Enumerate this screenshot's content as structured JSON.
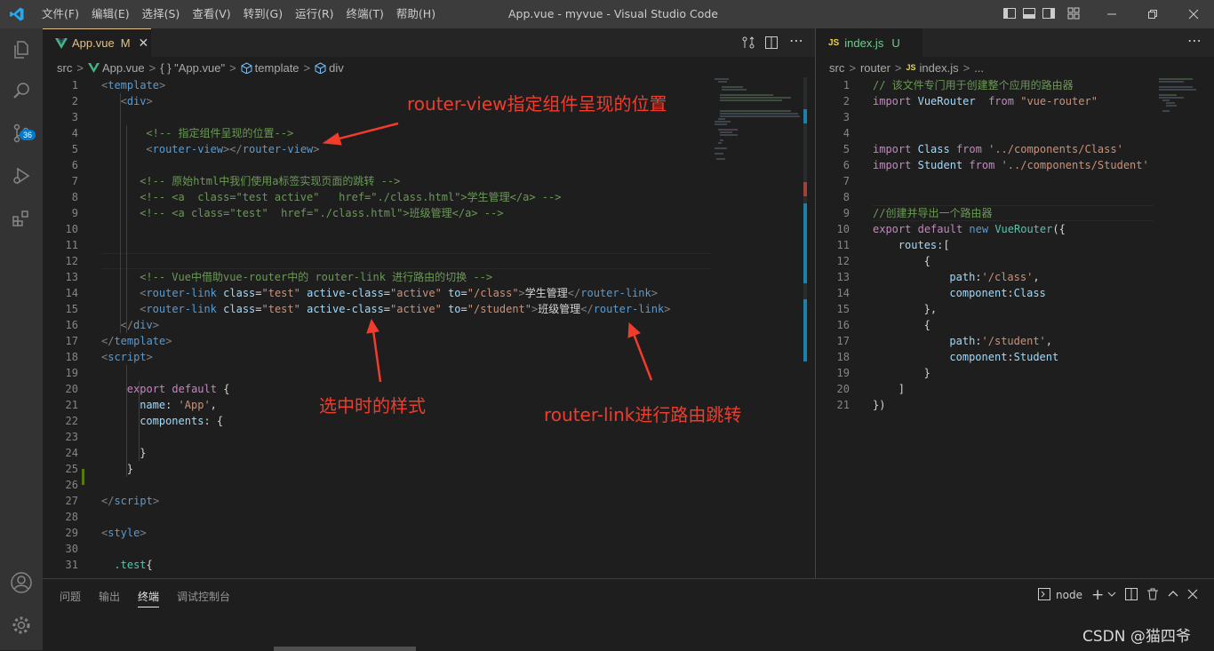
{
  "titlebar": {
    "menu": [
      "文件(F)",
      "编辑(E)",
      "选择(S)",
      "查看(V)",
      "转到(G)",
      "运行(R)",
      "终端(T)",
      "帮助(H)"
    ],
    "title": "App.vue - myvue - Visual Studio Code"
  },
  "activity": {
    "scm_badge": "36"
  },
  "left_tab": {
    "name": "App.vue",
    "status": "M"
  },
  "left_breadcrumb": [
    "src",
    "App.vue",
    "{ } \"App.vue\"",
    "template",
    "div"
  ],
  "right_tab": {
    "lang": "JS",
    "name": "index.js",
    "status": "U"
  },
  "right_breadcrumb": [
    "src",
    "router",
    "index.js",
    "..."
  ],
  "left_lines": [
    {
      "n": "1",
      "t": [
        [
          "t-pun",
          "<"
        ],
        [
          "t-tag",
          "template"
        ],
        [
          "t-pun",
          ">"
        ]
      ],
      "i": 0
    },
    {
      "n": "2",
      "t": [
        [
          "t-pun",
          "<"
        ],
        [
          "t-tag",
          "div"
        ],
        [
          "t-pun",
          ">"
        ]
      ],
      "i": 3
    },
    {
      "n": "3",
      "t": [],
      "i": 0
    },
    {
      "n": "4",
      "t": [
        [
          "t-com",
          "<!-- 指定组件呈现的位置-->"
        ]
      ],
      "i": 7
    },
    {
      "n": "5",
      "t": [
        [
          "t-pun",
          "<"
        ],
        [
          "t-tag",
          "router-view"
        ],
        [
          "t-pun",
          "></"
        ],
        [
          "t-tag",
          "router-view"
        ],
        [
          "t-pun",
          ">"
        ]
      ],
      "i": 7
    },
    {
      "n": "6",
      "t": [],
      "i": 0
    },
    {
      "n": "7",
      "t": [
        [
          "t-com",
          "<!-- 原始html中我们使用a标签实现页面的跳转 -->"
        ]
      ],
      "i": 6
    },
    {
      "n": "8",
      "t": [
        [
          "t-com",
          "<!-- <a  class=\"test active\"   href=\"./class.html\">学生管理</a> -->"
        ]
      ],
      "i": 6
    },
    {
      "n": "9",
      "t": [
        [
          "t-com",
          "<!-- <a class=\"test\"  href=\"./class.html\">班级管理</a> -->"
        ]
      ],
      "i": 6
    },
    {
      "n": "10",
      "t": [],
      "i": 0
    },
    {
      "n": "11",
      "t": [],
      "i": 0
    },
    {
      "n": "12",
      "t": [],
      "i": 0
    },
    {
      "n": "13",
      "t": [
        [
          "t-com",
          "<!-- Vue中借助vue-router中的 router-link 进行路由的切换 -->"
        ]
      ],
      "i": 6
    },
    {
      "n": "14",
      "t": [
        [
          "t-pun",
          "<"
        ],
        [
          "t-tag",
          "router-link"
        ],
        [
          "t-txt",
          " "
        ],
        [
          "t-attr",
          "class"
        ],
        [
          "t-txt",
          "="
        ],
        [
          "t-str",
          "\"test\""
        ],
        [
          "t-txt",
          " "
        ],
        [
          "t-attr",
          "active-class"
        ],
        [
          "t-txt",
          "="
        ],
        [
          "t-str",
          "\"active\""
        ],
        [
          "t-txt",
          " "
        ],
        [
          "t-attr",
          "to"
        ],
        [
          "t-txt",
          "="
        ],
        [
          "t-str",
          "\"/class\""
        ],
        [
          "t-pun",
          ">"
        ],
        [
          "t-txt",
          "学生管理"
        ],
        [
          "t-pun",
          "</"
        ],
        [
          "t-tag",
          "router-link"
        ],
        [
          "t-pun",
          ">"
        ]
      ],
      "i": 6
    },
    {
      "n": "15",
      "t": [
        [
          "t-pun",
          "<"
        ],
        [
          "t-tag",
          "router-link"
        ],
        [
          "t-txt",
          " "
        ],
        [
          "t-attr",
          "class"
        ],
        [
          "t-txt",
          "="
        ],
        [
          "t-str",
          "\"test\""
        ],
        [
          "t-txt",
          " "
        ],
        [
          "t-attr",
          "active-class"
        ],
        [
          "t-txt",
          "="
        ],
        [
          "t-str",
          "\"active\""
        ],
        [
          "t-txt",
          " "
        ],
        [
          "t-attr",
          "to"
        ],
        [
          "t-txt",
          "="
        ],
        [
          "t-str",
          "\"/student\""
        ],
        [
          "t-pun",
          ">"
        ],
        [
          "t-txt",
          "班级管理"
        ],
        [
          "t-pun",
          "</"
        ],
        [
          "t-tag",
          "router-link"
        ],
        [
          "t-pun",
          ">"
        ]
      ],
      "i": 6
    },
    {
      "n": "16",
      "t": [
        [
          "t-pun",
          "</"
        ],
        [
          "t-tag",
          "div"
        ],
        [
          "t-pun",
          ">"
        ]
      ],
      "i": 3
    },
    {
      "n": "17",
      "t": [
        [
          "t-pun",
          "</"
        ],
        [
          "t-tag",
          "template"
        ],
        [
          "t-pun",
          ">"
        ]
      ],
      "i": 0
    },
    {
      "n": "18",
      "t": [
        [
          "t-pun",
          "<"
        ],
        [
          "t-tag",
          "script"
        ],
        [
          "t-pun",
          ">"
        ]
      ],
      "i": 0
    },
    {
      "n": "19",
      "t": [],
      "i": 0
    },
    {
      "n": "20",
      "t": [
        [
          "t-kw",
          "export"
        ],
        [
          "t-txt",
          " "
        ],
        [
          "t-kw",
          "default"
        ],
        [
          "t-txt",
          " {"
        ]
      ],
      "i": 4
    },
    {
      "n": "21",
      "t": [
        [
          "t-attr",
          "name"
        ],
        [
          "t-txt",
          ": "
        ],
        [
          "t-str",
          "'App'"
        ],
        [
          "t-txt",
          ","
        ]
      ],
      "i": 6
    },
    {
      "n": "22",
      "t": [
        [
          "t-attr",
          "components"
        ],
        [
          "t-txt",
          ": {"
        ]
      ],
      "i": 6
    },
    {
      "n": "23",
      "t": [],
      "i": 0
    },
    {
      "n": "24",
      "t": [
        [
          "t-txt",
          "}"
        ]
      ],
      "i": 6
    },
    {
      "n": "25",
      "t": [
        [
          "t-txt",
          "}"
        ]
      ],
      "i": 4
    },
    {
      "n": "26",
      "t": [],
      "i": 0
    },
    {
      "n": "27",
      "t": [
        [
          "t-pun",
          "</"
        ],
        [
          "t-tag",
          "script"
        ],
        [
          "t-pun",
          ">"
        ]
      ],
      "i": 0
    },
    {
      "n": "28",
      "t": [],
      "i": 0
    },
    {
      "n": "29",
      "t": [
        [
          "t-pun",
          "<"
        ],
        [
          "t-tag",
          "style"
        ],
        [
          "t-pun",
          ">"
        ]
      ],
      "i": 0
    },
    {
      "n": "30",
      "t": [],
      "i": 0
    },
    {
      "n": "31",
      "t": [
        [
          "t-cls",
          ".test"
        ],
        [
          "t-txt",
          "{"
        ]
      ],
      "i": 2
    }
  ],
  "right_lines": [
    {
      "n": "1",
      "t": [
        [
          "t-com",
          "// 该文件专门用于创建整个应用的路由器"
        ]
      ],
      "i": 0
    },
    {
      "n": "2",
      "t": [
        [
          "t-kw",
          "import"
        ],
        [
          "t-txt",
          " "
        ],
        [
          "t-attr",
          "VueRouter"
        ],
        [
          "t-txt",
          "  "
        ],
        [
          "t-kw",
          "from"
        ],
        [
          "t-txt",
          " "
        ],
        [
          "t-str",
          "\"vue-router\""
        ]
      ],
      "i": 0
    },
    {
      "n": "3",
      "t": [],
      "i": 0
    },
    {
      "n": "4",
      "t": [],
      "i": 0
    },
    {
      "n": "5",
      "t": [
        [
          "t-kw",
          "import"
        ],
        [
          "t-txt",
          " "
        ],
        [
          "t-attr",
          "Class"
        ],
        [
          "t-txt",
          " "
        ],
        [
          "t-kw",
          "from"
        ],
        [
          "t-txt",
          " "
        ],
        [
          "t-str",
          "'../components/Class'"
        ]
      ],
      "i": 0
    },
    {
      "n": "6",
      "t": [
        [
          "t-kw",
          "import"
        ],
        [
          "t-txt",
          " "
        ],
        [
          "t-attr",
          "Student"
        ],
        [
          "t-txt",
          " "
        ],
        [
          "t-kw",
          "from"
        ],
        [
          "t-txt",
          " "
        ],
        [
          "t-str",
          "'../components/Student'"
        ]
      ],
      "i": 0
    },
    {
      "n": "7",
      "t": [],
      "i": 0
    },
    {
      "n": "8",
      "t": [],
      "i": 0
    },
    {
      "n": "9",
      "t": [
        [
          "t-com",
          "//创建并导出一个路由器"
        ]
      ],
      "i": 0
    },
    {
      "n": "10",
      "t": [
        [
          "t-kw",
          "export"
        ],
        [
          "t-txt",
          " "
        ],
        [
          "t-kw",
          "default"
        ],
        [
          "t-txt",
          " "
        ],
        [
          "t-kwb",
          "new"
        ],
        [
          "t-txt",
          " "
        ],
        [
          "t-cls",
          "VueRouter"
        ],
        [
          "t-txt",
          "({"
        ]
      ],
      "i": 0
    },
    {
      "n": "11",
      "t": [
        [
          "t-attr",
          "routes"
        ],
        [
          "t-txt",
          ":["
        ]
      ],
      "i": 4
    },
    {
      "n": "12",
      "t": [
        [
          "t-txt",
          "{"
        ]
      ],
      "i": 8
    },
    {
      "n": "13",
      "t": [
        [
          "t-attr",
          "path"
        ],
        [
          "t-txt",
          ":"
        ],
        [
          "t-str",
          "'/class'"
        ],
        [
          "t-txt",
          ","
        ]
      ],
      "i": 12
    },
    {
      "n": "14",
      "t": [
        [
          "t-attr",
          "component"
        ],
        [
          "t-txt",
          ":"
        ],
        [
          "t-attr",
          "Class"
        ]
      ],
      "i": 12
    },
    {
      "n": "15",
      "t": [
        [
          "t-txt",
          "},"
        ]
      ],
      "i": 8
    },
    {
      "n": "16",
      "t": [
        [
          "t-txt",
          "{"
        ]
      ],
      "i": 8
    },
    {
      "n": "17",
      "t": [
        [
          "t-attr",
          "path"
        ],
        [
          "t-txt",
          ":"
        ],
        [
          "t-str",
          "'/student'"
        ],
        [
          "t-txt",
          ","
        ]
      ],
      "i": 12
    },
    {
      "n": "18",
      "t": [
        [
          "t-attr",
          "component"
        ],
        [
          "t-txt",
          ":"
        ],
        [
          "t-attr",
          "Student"
        ]
      ],
      "i": 12
    },
    {
      "n": "19",
      "t": [
        [
          "t-txt",
          "}"
        ]
      ],
      "i": 8
    },
    {
      "n": "20",
      "t": [
        [
          "t-txt",
          "]"
        ]
      ],
      "i": 4
    },
    {
      "n": "21",
      "t": [
        [
          "t-txt",
          "})"
        ]
      ],
      "i": 0
    }
  ],
  "panel": {
    "tabs": [
      "问题",
      "输出",
      "终端",
      "调试控制台"
    ],
    "active": "终端",
    "shell": "node"
  },
  "annotations": {
    "router_view": "router-view指定组件呈现的位置",
    "active_style": "选中时的样式",
    "router_link": "router-link进行路由跳转"
  },
  "watermark": "CSDN @猫四爷",
  "colors": {
    "annotation": "#f23c2b",
    "accent": "#007acc"
  }
}
